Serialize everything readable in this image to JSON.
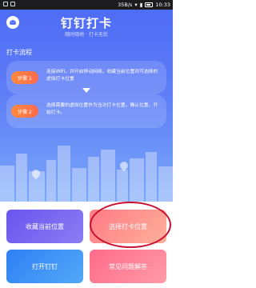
{
  "status": {
    "network": "35B/s",
    "time": "10:33"
  },
  "header": {
    "title": "钉钉打卡",
    "subtitle": "随时随地 · 打卡无忧"
  },
  "flow": {
    "title": "打卡流程",
    "steps": [
      {
        "label": "步骤 1",
        "text": "连接WiFi，并开启移动网络，收藏当前位置到可选择的虚拟打卡位置"
      },
      {
        "label": "步骤 2",
        "text": "选择需要的虚拟位置作为当次打卡位置，确认位置，开始打卡。"
      }
    ]
  },
  "buttons": {
    "collect": "收藏当前位置",
    "select": "选择打卡位置",
    "open": "打开钉钉",
    "faq": "常见问题解答"
  },
  "colors": {
    "hero_top": "#4f6cf5",
    "accent_orange": "#ff7a45",
    "highlight_circle": "#c8102e"
  }
}
